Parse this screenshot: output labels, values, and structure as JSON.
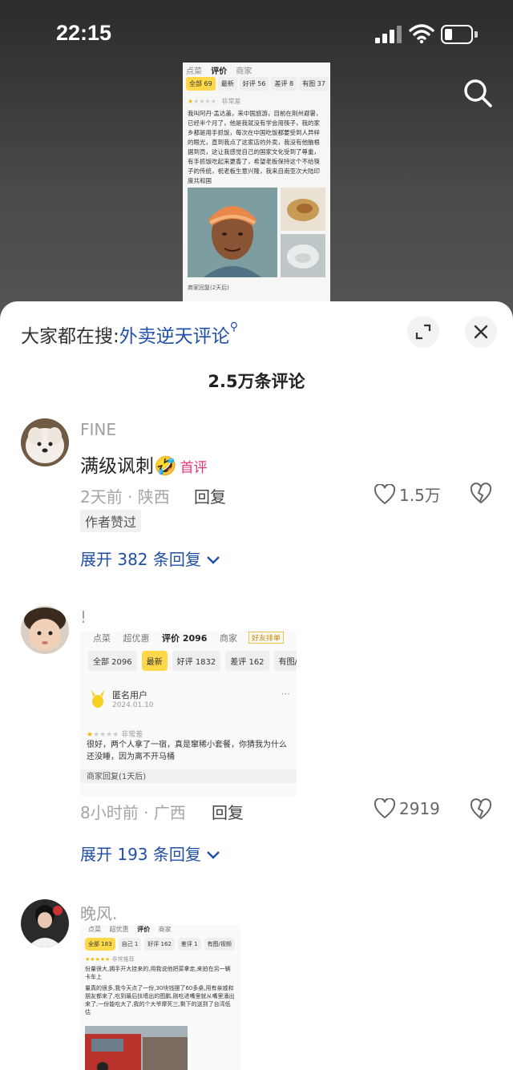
{
  "status_bar": {
    "time": "22:15"
  },
  "video_card": {
    "tabs": [
      "点菜",
      "评价",
      "商家"
    ],
    "filters": [
      "全部 69",
      "最新",
      "好评 56",
      "差评 8",
      "有图 37"
    ],
    "review_label": "非常差",
    "review_text": "我叫阿丹·孟达盖，来中国旅游，目前在荆州避暑，已经半个月了，他是我就没有学会用筷子，我的家乡都是用手抓饭，每次在中国吃饭都要受到人异样的眼光，直到我点了这家店的外卖，我没有他脑根据到员，这让我感觉自己的国家文化受到了尊重，有手抓饭吃起来更香了，希望老板保持这个不给筷子的传统，祝老板生意兴隆，我来自南亚次大陆印度共和国",
    "reply_label": "商家回复(2天后)"
  },
  "sheet": {
    "search_prefix": "大家都在搜:",
    "search_keyword": "外卖逆天评论",
    "title": "2.5万条评论"
  },
  "comments": [
    {
      "username": "FINE",
      "text": "满级讽刺",
      "emoji": "🤣",
      "badge": "首评",
      "meta": "2天前 · 陕西",
      "reply_label": "回复",
      "likes": "1.5万",
      "author_liked": "作者赞过",
      "expand": "展开 382 条回复"
    },
    {
      "username": "!",
      "embed": {
        "tabs": [
          "点菜",
          "超优惠",
          "评价 2096",
          "商家"
        ],
        "tag": "好友排单",
        "filters": [
          "全部 2096",
          "最新",
          "好评 1832",
          "差评 162",
          "有图/视频"
        ],
        "user": "匿名用户",
        "date": "2024.01.10",
        "rating_label": "非常差",
        "text_1": "很好，两个人拿了一宿，真是窜稀小套餐，你猜我为什么",
        "text_2": "还没睡，因为离不开马桶",
        "reply_label": "商家回复(1天后)"
      },
      "meta": "8小时前 · 广西",
      "reply_label": "回复",
      "likes": "2919",
      "expand": "展开 193 条回复"
    },
    {
      "username": "晚风.",
      "embed": {
        "tabs": [
          "点菜",
          "超优惠",
          "评价",
          "商家"
        ],
        "filters": [
          "全部 183",
          "自己 1",
          "好评 162",
          "差评 1",
          "有图/视频"
        ],
        "rating_label": "非常推荐",
        "text_1": "份量很大,拥手开大挂来的,用我说他把菜拿走,来拍在另一辆卡车上",
        "text_2": "量真的很多,我今天点了一份,30块钱摆了60多桌,用有亲戚和朋友都来了,吃到最后扶墙出的图鹏,刚吃进嘴里就从嘴里涌出来了,一份能吃大了,我的个大爷摩死三,剩下的送到了台湾低估"
      }
    }
  ],
  "colors": {
    "accent_blue": "#1f4fa8",
    "badge_pink": "#e8337a",
    "chip_yellow": "#ffd84a"
  }
}
